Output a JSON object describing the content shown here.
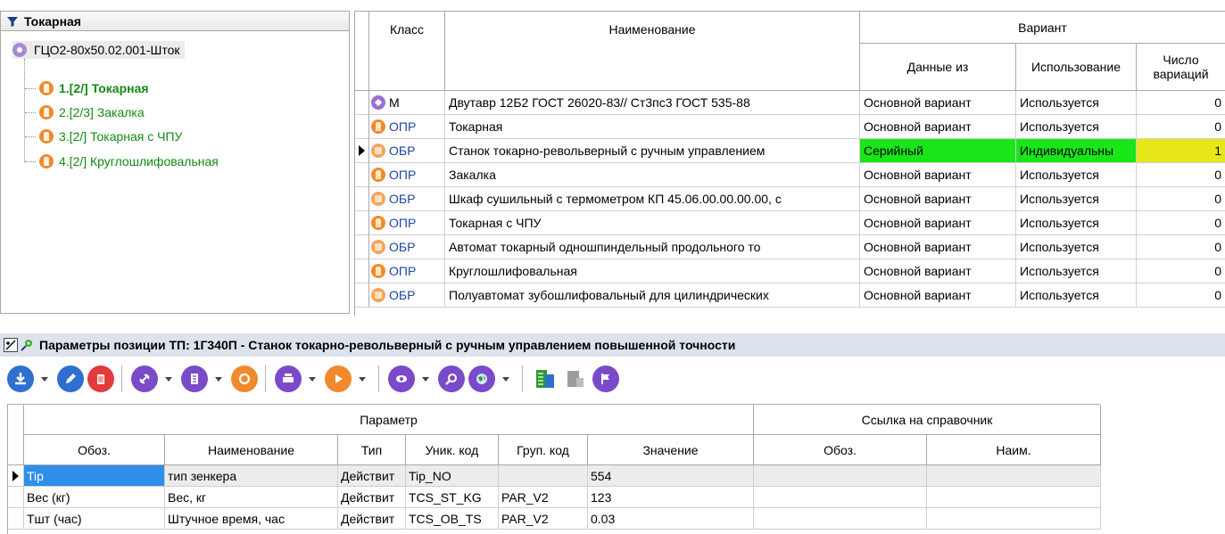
{
  "tree": {
    "header": "Токарная",
    "root": "ГЦО2-80х50.02.001-Шток",
    "items": [
      {
        "label": "1.[2/] Токарная",
        "bold": true
      },
      {
        "label": "2.[2/3] Закалка",
        "bold": false
      },
      {
        "label": "3.[2/] Токарная с ЧПУ",
        "bold": false
      },
      {
        "label": "4.[2/] Круглошлифовальная",
        "bold": false
      }
    ]
  },
  "grid": {
    "headers": {
      "class": "Класс",
      "name": "Наименование",
      "variant": "Вариант",
      "data_from": "Данные из",
      "usage": "Использование",
      "variations": "Число вариаций"
    },
    "rows": [
      {
        "icon": "beam-icon",
        "class": "М",
        "name": "Двутавр 12Б2 ГОСТ 26020-83// Ст3пс3 ГОСТ 535-88",
        "data_from": "Основной вариант",
        "usage": "Используется",
        "count": "0"
      },
      {
        "icon": "operation-icon",
        "class": "ОПР",
        "name": "Токарная",
        "data_from": "Основной вариант",
        "usage": "Используется",
        "count": "0"
      },
      {
        "icon": "equipment-icon",
        "class": "ОБР",
        "name": "Станок токарно-револьверный с ручным управлением",
        "data_from": "Серийный",
        "usage": "Индивидуальны",
        "count": "1",
        "selected": true
      },
      {
        "icon": "operation-icon",
        "class": "ОПР",
        "name": "Закалка",
        "data_from": "Основной вариант",
        "usage": "Используется",
        "count": "0"
      },
      {
        "icon": "equipment-icon",
        "class": "ОБР",
        "name": "Шкаф сушильный с термометром КП 45.06.00.00.00.00, с",
        "data_from": "Основной вариант",
        "usage": "Используется",
        "count": "0"
      },
      {
        "icon": "operation-icon",
        "class": "ОПР",
        "name": "Токарная с ЧПУ",
        "data_from": "Основной вариант",
        "usage": "Используется",
        "count": "0"
      },
      {
        "icon": "equipment-icon",
        "class": "ОБР",
        "name": "Автомат токарный одношпиндельный продольного то",
        "data_from": "Основной вариант",
        "usage": "Используется",
        "count": "0"
      },
      {
        "icon": "operation-icon",
        "class": "ОПР",
        "name": "Круглошлифовальная",
        "data_from": "Основной вариант",
        "usage": "Используется",
        "count": "0"
      },
      {
        "icon": "equipment-icon",
        "class": "ОБР",
        "name": "Полуавтомат зубошлифовальный для цилиндрических",
        "data_from": "Основной вариант",
        "usage": "Используется",
        "count": "0"
      }
    ],
    "colors": {
      "green": "#19e619",
      "yellow": "#e6e619"
    }
  },
  "param_panel": {
    "title": "Параметры позиции ТП: 1Г340П - Станок токарно-револьверный с ручным управлением повышенной точности"
  },
  "toolbar": {
    "buttons": [
      "download-icon",
      "edit-icon",
      "delete-icon",
      "link-icon",
      "document-icon",
      "refresh-icon",
      "print-icon",
      "play-icon",
      "view-icon",
      "search-icon",
      "globe-icon",
      "calculator-icon",
      "stack-icon",
      "flag-icon"
    ]
  },
  "params": {
    "headers": {
      "param": "Параметр",
      "ref": "Ссылка на справочник",
      "oboz": "Обоз.",
      "name": "Наименование",
      "type": "Тип",
      "uniq": "Уник. код",
      "group": "Груп. код",
      "value": "Значение",
      "ref_oboz": "Обоз.",
      "ref_name": "Наим."
    },
    "rows": [
      {
        "oboz": "Tip",
        "name": "тип зенкера",
        "type": "Действит",
        "uniq": "Tip_NO",
        "group": "",
        "value": "554",
        "selected": true
      },
      {
        "oboz": "Вес (кг)",
        "name": "Вес, кг",
        "type": "Действит",
        "uniq": "TCS_ST_KG",
        "group": "PAR_V2",
        "value": "123"
      },
      {
        "oboz": "Тшт (час)",
        "name": "Штучное время, час",
        "type": "Действит",
        "uniq": "TCS_OB_TS",
        "group": "PAR_V2",
        "value": "0.03"
      }
    ]
  }
}
